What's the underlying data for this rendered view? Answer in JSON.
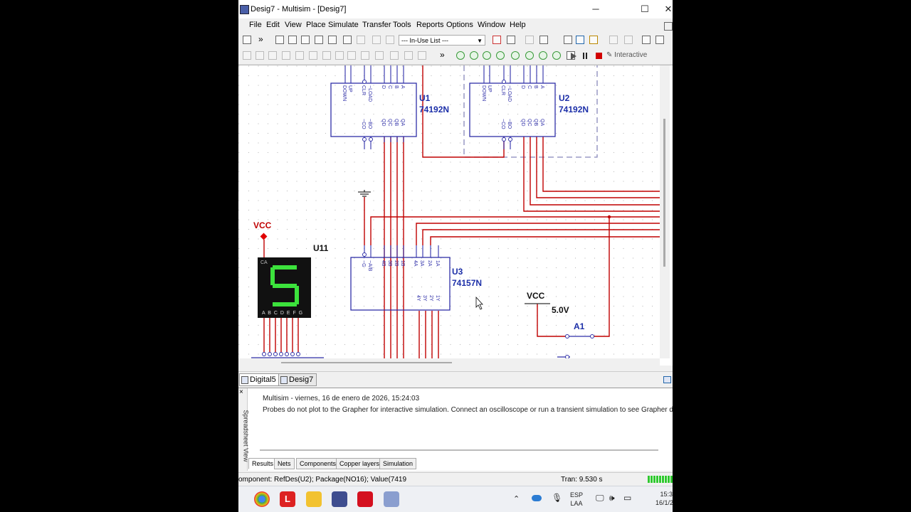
{
  "window": {
    "title": "Desig7 - Multisim - [Desig7]",
    "minimize": "─",
    "maximize": "☐",
    "close": "✕"
  },
  "menu": {
    "items": [
      {
        "label": "File"
      },
      {
        "label": "Edit"
      },
      {
        "label": "View"
      },
      {
        "label": "Place"
      },
      {
        "label": "Simulate"
      },
      {
        "label": "Transfer"
      },
      {
        "label": "Tools"
      },
      {
        "label": "Reports"
      },
      {
        "label": "Options"
      },
      {
        "label": "Window"
      },
      {
        "label": "Help"
      }
    ]
  },
  "toolbar": {
    "inuse_list": "--- In-Use List ---",
    "interactive": "Interactive",
    "expand": "»"
  },
  "schematic": {
    "u1": {
      "ref": "U1",
      "part": "74192N",
      "top_pins": [
        "DOWN",
        "UP",
        "CLR",
        "~LOAD",
        "D",
        "C",
        "B",
        "A"
      ],
      "bottom_pins": [
        "~CO",
        "~BO",
        "QD",
        "QC",
        "QB",
        "QA"
      ]
    },
    "u2": {
      "ref": "U2",
      "part": "74192N",
      "top_pins": [
        "DOWN",
        "UP",
        "CLR",
        "~LOAD",
        "D",
        "C",
        "B",
        "A"
      ],
      "bottom_pins": [
        "~CO",
        "~BO",
        "QD",
        "QC",
        "QB",
        "QA"
      ]
    },
    "u3": {
      "ref": "U3",
      "part": "74157N",
      "top_pins": [
        "~G",
        "~A/B",
        "4B",
        "3B",
        "2B",
        "1B",
        "4A",
        "3A",
        "2A",
        "1A"
      ],
      "bottom_pins": [
        "4Y",
        "3Y",
        "2Y",
        "1Y"
      ]
    },
    "u11": {
      "ref": "U11",
      "digit": "5",
      "label_ca": "CA",
      "segments": "A B C D E F G"
    },
    "vcc_left": "VCC",
    "vcc_right": "VCC",
    "voltage": "5.0V",
    "switch": "A1"
  },
  "sheet_tabs": [
    {
      "label": "Digital5"
    },
    {
      "label": "Desig7"
    }
  ],
  "spreadsheet": {
    "side_label": "Spreadsheet View",
    "close": "×",
    "message_header": "Multisim  -  viernes, 16 de enero de 2026, 15:24:03",
    "message_body": "Probes do not plot to the Grapher for interactive simulation. Connect an oscilloscope or run a transient simulation to see Grapher da",
    "tabs": [
      {
        "label": "Results"
      },
      {
        "label": "Nets"
      },
      {
        "label": "Components"
      },
      {
        "label": "Copper layers"
      },
      {
        "label": "Simulation"
      }
    ]
  },
  "status": {
    "component": "omponent: RefDes(U2); Package(NO16); Value(7419",
    "tran": "Tran: 9.530 s"
  },
  "taskbar": {
    "lang": "ESP",
    "lang2": "LAA",
    "time": "15:3",
    "date": "16/1/202"
  }
}
